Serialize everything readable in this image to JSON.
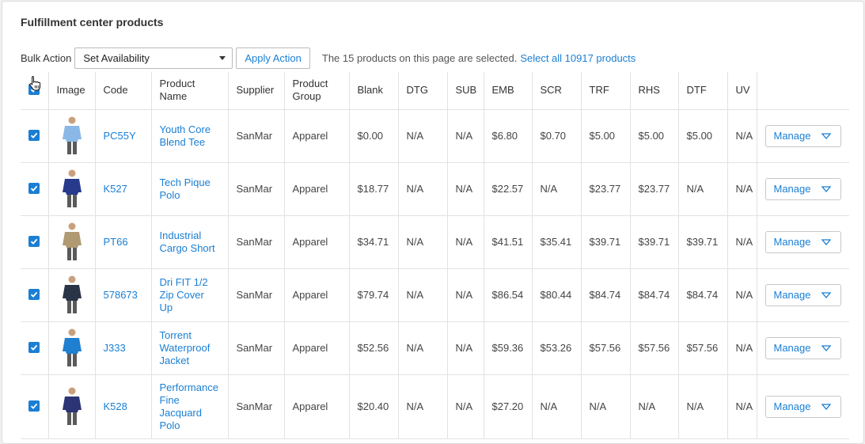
{
  "page": {
    "title": "Fulfillment center products"
  },
  "toolbar": {
    "bulk_label": "Bulk Action",
    "select_value": "Set Availability",
    "apply_label": "Apply Action",
    "selected_message": "The 15 products on this page are selected.",
    "select_all_link": "Select all 10917 products"
  },
  "columns": [
    "Image",
    "Code",
    "Product Name",
    "Supplier",
    "Product Group",
    "Blank",
    "DTG",
    "SUB",
    "EMB",
    "SCR",
    "TRF",
    "RHS",
    "DTF",
    "UV"
  ],
  "manage_label": "Manage",
  "rows": [
    {
      "code": "PC55Y",
      "name": "Youth Core Blend Tee",
      "supplier": "SanMar",
      "group": "Apparel",
      "blank": "$0.00",
      "dtg": "N/A",
      "sub": "N/A",
      "emb": "$6.80",
      "scr": "$0.70",
      "trf": "$5.00",
      "rhs": "$5.00",
      "dtf": "$5.00",
      "uv": "N/A",
      "image_icon": "light-blue-tshirt",
      "color": "#8ab8e6"
    },
    {
      "code": "K527",
      "name": "Tech Pique Polo",
      "supplier": "SanMar",
      "group": "Apparel",
      "blank": "$18.77",
      "dtg": "N/A",
      "sub": "N/A",
      "emb": "$22.57",
      "scr": "N/A",
      "trf": "$23.77",
      "rhs": "$23.77",
      "dtf": "N/A",
      "uv": "N/A",
      "image_icon": "navy-polo",
      "color": "#283a8c"
    },
    {
      "code": "PT66",
      "name": "Industrial Cargo Short",
      "supplier": "SanMar",
      "group": "Apparel",
      "blank": "$34.71",
      "dtg": "N/A",
      "sub": "N/A",
      "emb": "$41.51",
      "scr": "$35.41",
      "trf": "$39.71",
      "rhs": "$39.71",
      "dtf": "$39.71",
      "uv": "N/A",
      "image_icon": "khaki-cargo-short",
      "color": "#b09a72"
    },
    {
      "code": "578673",
      "name": "Dri FIT 1/2 Zip Cover Up",
      "supplier": "SanMar",
      "group": "Apparel",
      "blank": "$79.74",
      "dtg": "N/A",
      "sub": "N/A",
      "emb": "$86.54",
      "scr": "$80.44",
      "trf": "$84.74",
      "rhs": "$84.74",
      "dtf": "$84.74",
      "uv": "N/A",
      "image_icon": "dark-navy-pullover",
      "color": "#2a3447"
    },
    {
      "code": "J333",
      "name": "Torrent Waterproof Jacket",
      "supplier": "SanMar",
      "group": "Apparel",
      "blank": "$52.56",
      "dtg": "N/A",
      "sub": "N/A",
      "emb": "$59.36",
      "scr": "$53.26",
      "trf": "$57.56",
      "rhs": "$57.56",
      "dtf": "$57.56",
      "uv": "N/A",
      "image_icon": "blue-jacket",
      "color": "#1f7fd0"
    },
    {
      "code": "K528",
      "name": "Performance Fine Jacquard Polo",
      "supplier": "SanMar",
      "group": "Apparel",
      "blank": "$20.40",
      "dtg": "N/A",
      "sub": "N/A",
      "emb": "$27.20",
      "scr": "N/A",
      "trf": "N/A",
      "rhs": "N/A",
      "dtf": "N/A",
      "uv": "N/A",
      "image_icon": "navy-jacquard-polo",
      "color": "#2c3476"
    }
  ]
}
